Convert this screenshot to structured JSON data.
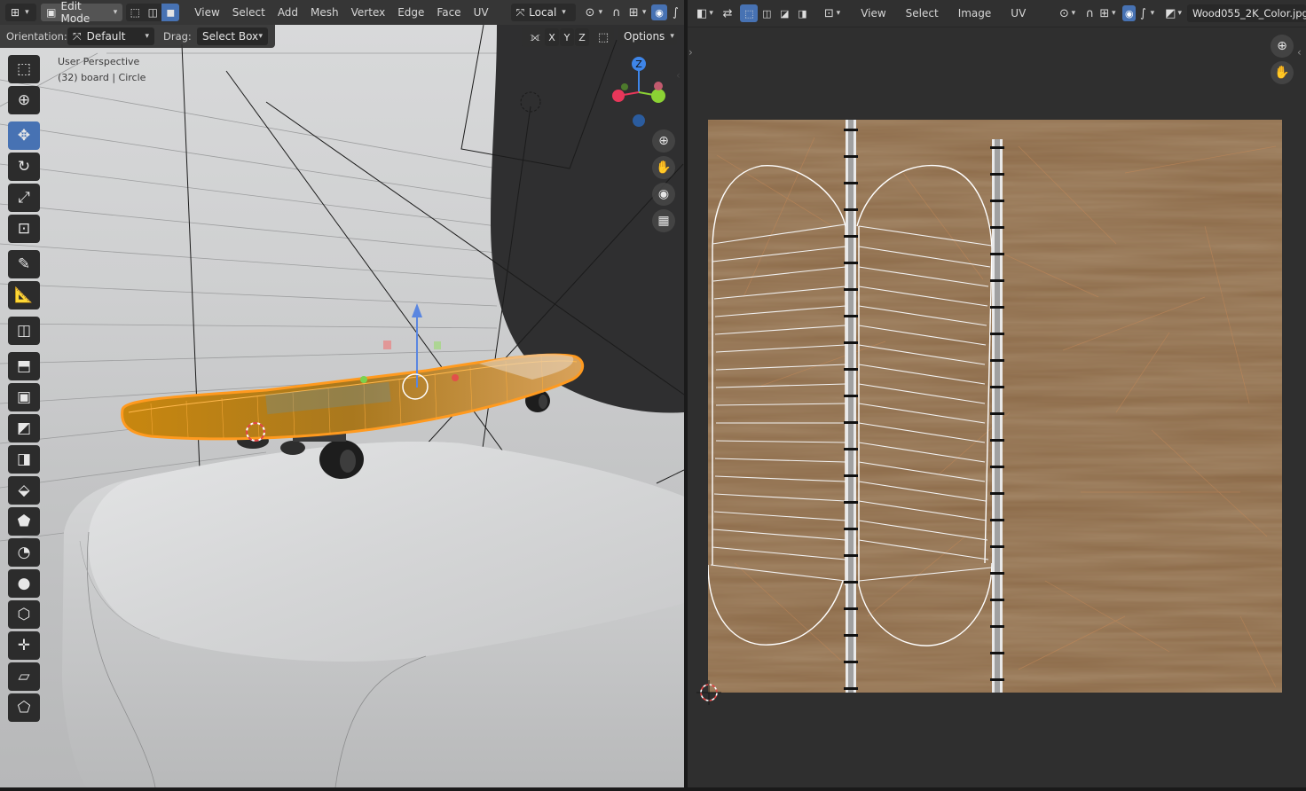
{
  "viewport_header": {
    "mode": "Edit Mode",
    "menus": [
      "View",
      "Select",
      "Add",
      "Mesh",
      "Vertex",
      "Edge",
      "Face",
      "UV"
    ],
    "transform_orientation": "Local"
  },
  "viewport_subheader": {
    "orientation_label": "Orientation:",
    "orientation_value": "Default",
    "drag_label": "Drag:",
    "drag_value": "Select Box",
    "axes": [
      "X",
      "Y",
      "Z"
    ],
    "options_label": "Options"
  },
  "viewport_overlay": {
    "perspective": "User Perspective",
    "object_info": "(32) board | Circle"
  },
  "gizmo": {
    "z": "Z",
    "x_color": "#e8375a",
    "y_color": "#8bd234",
    "z_color": "#3e85e8"
  },
  "tools": [
    "select-box",
    "cursor",
    "move",
    "rotate",
    "scale",
    "transform",
    "annotate",
    "measure",
    "add-cube",
    "extrude-region",
    "inset-faces",
    "bevel",
    "loop-cut",
    "knife",
    "poly-build",
    "spin",
    "smooth",
    "edge-slide",
    "shrink-fatten",
    "shear",
    "rip-region"
  ],
  "uv_header": {
    "menus": [
      "View",
      "Select",
      "Image",
      "UV"
    ],
    "image_name": "Wood055_2K_Color.jpg"
  },
  "colors": {
    "accent": "#4772b3",
    "selection_orange": "#ff9a1f",
    "wood": "#8d6a48"
  }
}
